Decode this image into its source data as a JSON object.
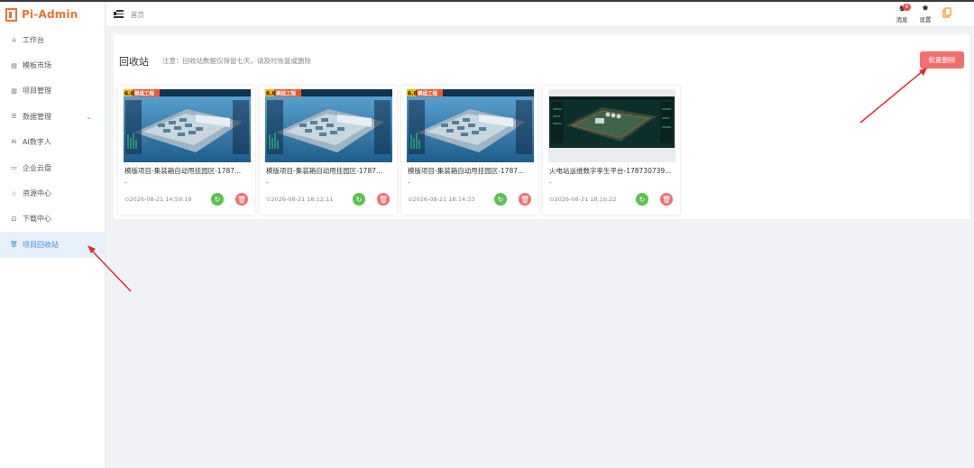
{
  "app": {
    "title": "Pi-Admin",
    "brand_color": "#e8772e"
  },
  "sidebar": {
    "items": [
      {
        "label": "工作台",
        "icon": "home-icon"
      },
      {
        "label": "模板市场",
        "icon": "template-icon"
      },
      {
        "label": "项目管理",
        "icon": "chart-icon"
      },
      {
        "label": "数据管理",
        "icon": "database-icon",
        "expandable": true
      },
      {
        "label": "AI数字人",
        "icon": "ai-icon"
      },
      {
        "label": "企业云盘",
        "icon": "folder-icon"
      },
      {
        "label": "资源中心",
        "icon": "star-icon"
      },
      {
        "label": "下载中心",
        "icon": "download-icon"
      },
      {
        "label": "项目回收站",
        "icon": "trash-icon",
        "active": true
      }
    ]
  },
  "header": {
    "breadcrumb": "首页",
    "messages_label": "消息",
    "messages_count": "6",
    "settings_label": "设置"
  },
  "main": {
    "title": "回收站",
    "notice": "注意：回收站数据仅保留七天，请及时恢复或删除",
    "batch_delete_label": "批量删除",
    "cards": [
      {
        "name": "模版项目-集装箱自动甩挂园区-1787...",
        "desc": "-",
        "date": "⊙2026-08-21 14:59:19",
        "thumb": "container"
      },
      {
        "name": "模版项目-集装箱自动甩挂园区-1787...",
        "desc": "-",
        "date": "⊙2026-08-21 18:12:11",
        "thumb": "container"
      },
      {
        "name": "模版项目-集装箱自动甩挂园区-1787...",
        "desc": "-",
        "date": "⊙2026-08-21 18:14:33",
        "thumb": "container"
      },
      {
        "name": "火电站运维数字孪生平台-178730739...",
        "desc": "-",
        "date": "⊙2026-08-21 18:16:22",
        "thumb": "plant"
      }
    ],
    "thumb_badge_num": "6.6",
    "thumb_badge_text": "模组工程",
    "accent_color": "#3d8fe3",
    "danger_color": "#f36f6f",
    "success_color": "#5bc14f"
  }
}
